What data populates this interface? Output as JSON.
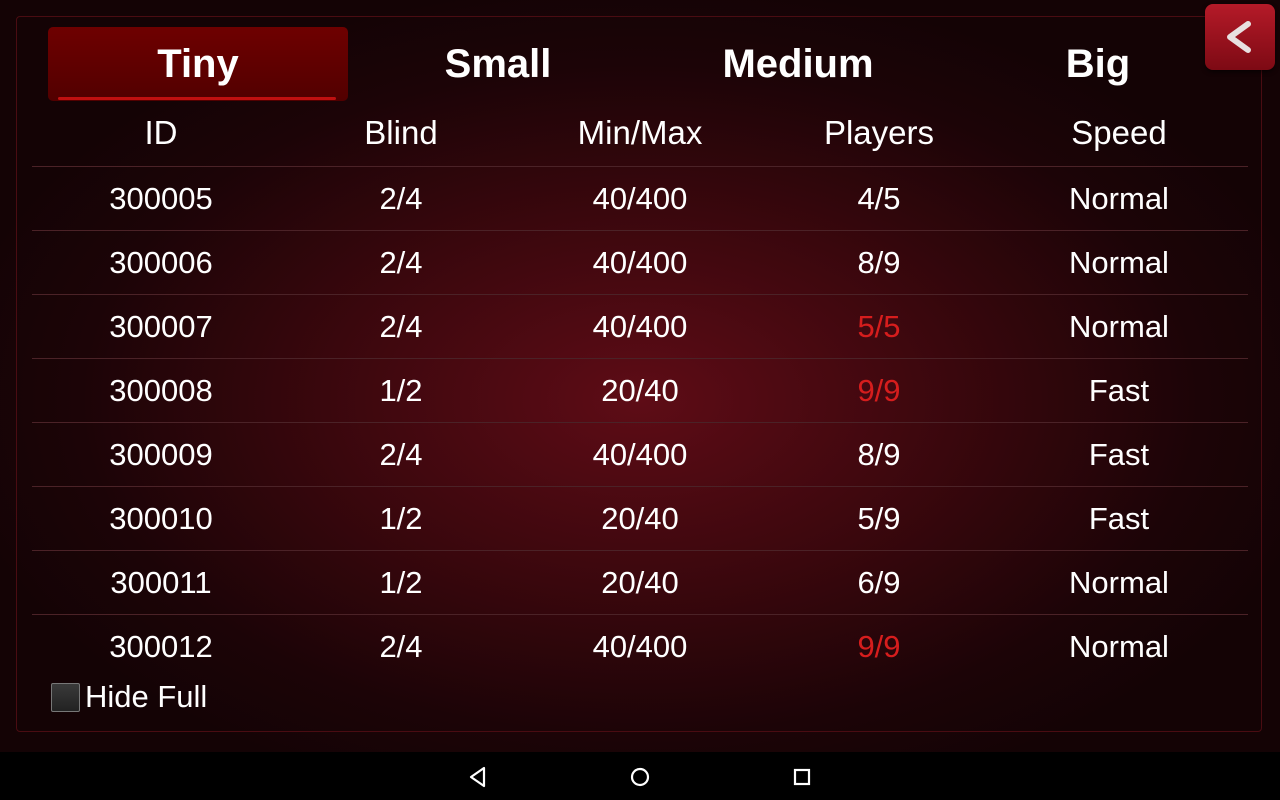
{
  "tabs": [
    {
      "label": "Tiny",
      "active": true
    },
    {
      "label": "Small",
      "active": false
    },
    {
      "label": "Medium",
      "active": false
    },
    {
      "label": "Big",
      "active": false
    }
  ],
  "table": {
    "headers": [
      "ID",
      "Blind",
      "Min/Max",
      "Players",
      "Speed"
    ],
    "rows": [
      {
        "id": "300005",
        "blind": "2/4",
        "minmax": "40/400",
        "players": "4/5",
        "speed": "Normal",
        "full": false
      },
      {
        "id": "300006",
        "blind": "2/4",
        "minmax": "40/400",
        "players": "8/9",
        "speed": "Normal",
        "full": false
      },
      {
        "id": "300007",
        "blind": "2/4",
        "minmax": "40/400",
        "players": "5/5",
        "speed": "Normal",
        "full": true
      },
      {
        "id": "300008",
        "blind": "1/2",
        "minmax": "20/40",
        "players": "9/9",
        "speed": "Fast",
        "full": true
      },
      {
        "id": "300009",
        "blind": "2/4",
        "minmax": "40/400",
        "players": "8/9",
        "speed": "Fast",
        "full": false
      },
      {
        "id": "300010",
        "blind": "1/2",
        "minmax": "20/40",
        "players": "5/9",
        "speed": "Fast",
        "full": false
      },
      {
        "id": "300011",
        "blind": "1/2",
        "minmax": "20/40",
        "players": "6/9",
        "speed": "Normal",
        "full": false
      },
      {
        "id": "300012",
        "blind": "2/4",
        "minmax": "40/400",
        "players": "9/9",
        "speed": "Normal",
        "full": true
      }
    ]
  },
  "hide_full": {
    "label": "Hide Full",
    "checked": false
  },
  "icons": {
    "back": "chevron-left-icon",
    "nav_back": "nav-back-icon",
    "nav_home": "nav-home-icon",
    "nav_recents": "nav-recents-icon"
  },
  "colors": {
    "full_players": "#d61d1d",
    "active_tab": "#6e0000",
    "back_button": "#b51a28"
  }
}
